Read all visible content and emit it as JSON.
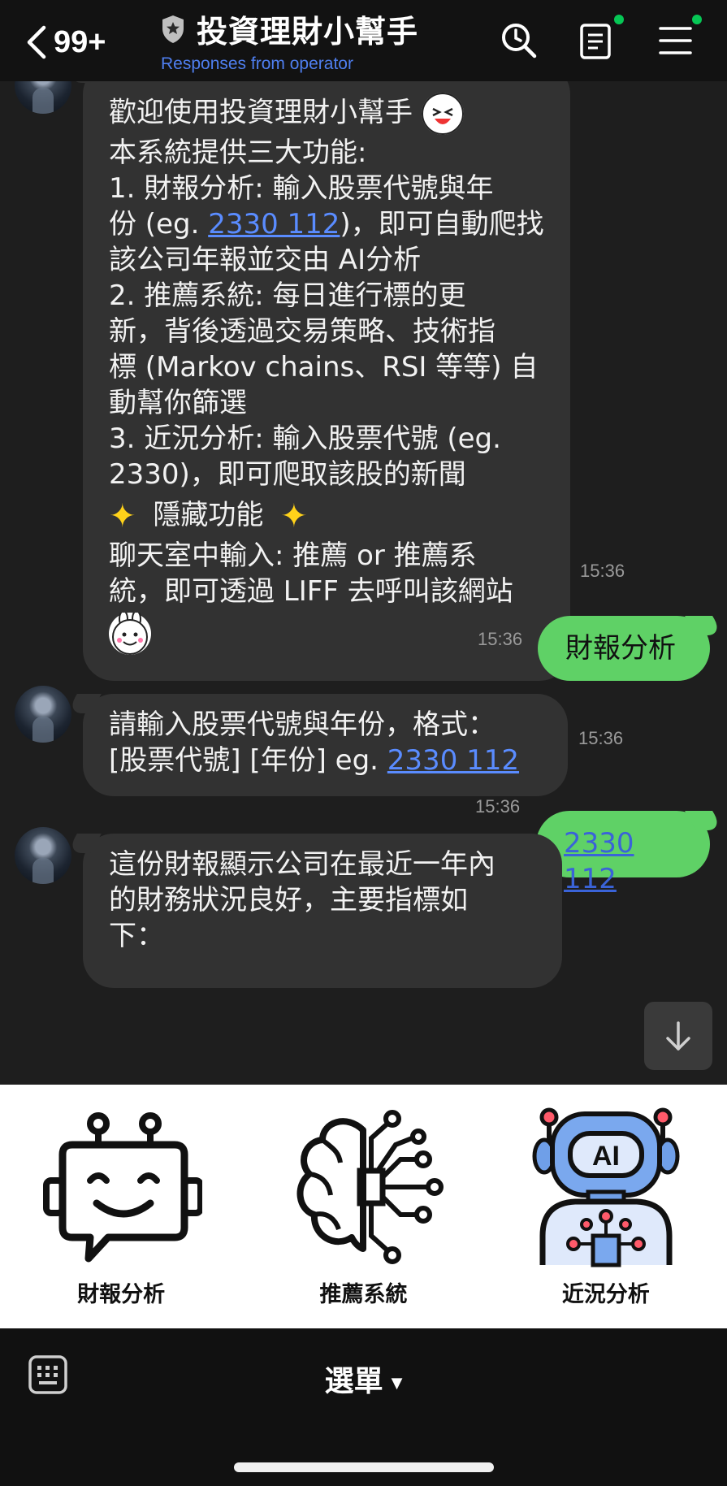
{
  "header": {
    "back_count": "99+",
    "title": "投資理財小幫手",
    "subtitle": "Responses from operator"
  },
  "messages": {
    "welcome": {
      "lines": [
        "歡迎使用投資理財小幫手",
        "本系統提供三大功能:",
        "1. 財報分析: 輸入股票代號與年",
        "份 (eg. ",
        "2330 112",
        ")，即可自動爬找",
        "該公司年報並交由 AI分析",
        "2. 推薦系統: 每日進行標的更",
        "新，背後透過交易策略、技術指",
        "標 (Markov chains、RSI 等等) 自",
        "動幫你篩選",
        "3. 近況分析: 輸入股票代號 (eg.",
        "2330)，即可爬取該股的新聞",
        "隱藏功能",
        "聊天室中輸入: 推薦 or 推薦系",
        "統，即可透過 LIFF 去呼叫該網站"
      ],
      "time": "15:36"
    },
    "user1": {
      "text": "財報分析",
      "time": "15:36"
    },
    "prompt": {
      "line1": "請輸入股票代號與年份，格式：",
      "line2_pre": "[股票代號] [年份] eg. ",
      "line2_link": "2330 112",
      "time": "15:36"
    },
    "user2": {
      "text": "2330 112",
      "time": "15:36"
    },
    "result": {
      "line1": "這份財報顯示公司在最近一年內",
      "line2": "的財務狀況良好，主要指標如",
      "line3": "下："
    }
  },
  "richmenu": {
    "items": [
      {
        "label": "財報分析",
        "icon": "robot-chat-icon"
      },
      {
        "label": "推薦系統",
        "icon": "brain-circuit-icon"
      },
      {
        "label": "近況分析",
        "icon": "ai-robot-icon"
      }
    ]
  },
  "bottom": {
    "menu_label": "選單"
  },
  "colors": {
    "accent_green": "#5fd166",
    "link_blue": "#5a8cff",
    "online_dot": "#06c755"
  }
}
